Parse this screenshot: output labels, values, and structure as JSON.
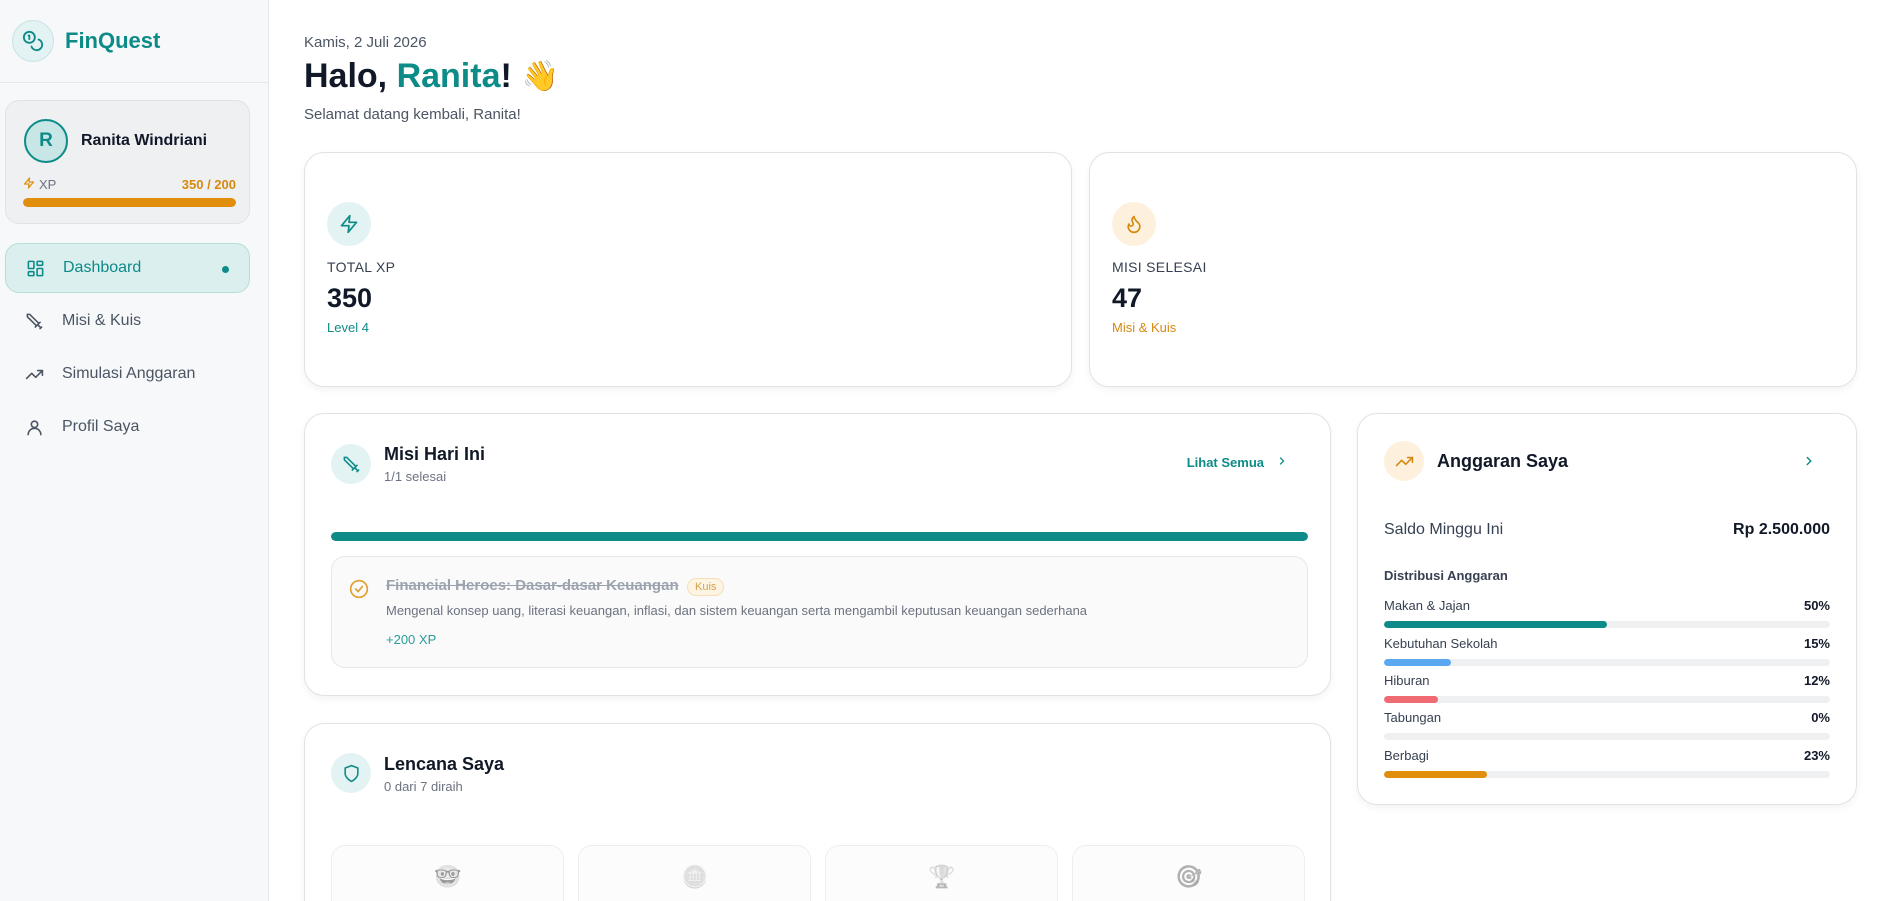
{
  "app": {
    "name": "FinQuest"
  },
  "user": {
    "initial": "R",
    "name": "Ranita Windriani",
    "xp_label": "XP",
    "xp_value": "350 / 200",
    "xp_progress": 1.0
  },
  "nav": {
    "items": [
      {
        "label": "Dashboard",
        "icon": "dashboard-icon",
        "active": true
      },
      {
        "label": "Misi & Kuis",
        "icon": "sword-icon"
      },
      {
        "label": "Simulasi Anggaran",
        "icon": "trending-up-icon"
      },
      {
        "label": "Profil Saya",
        "icon": "user-icon"
      }
    ]
  },
  "header": {
    "date": "Kamis, 2 Juli 2026",
    "greeting_prefix": "Halo, ",
    "greeting_name": "Ranita",
    "greeting_suffix": "!",
    "wave": "👋",
    "welcome": "Selamat datang kembali, Ranita!"
  },
  "stats": [
    {
      "label": "TOTAL XP",
      "value": "350",
      "sub": "Level 4",
      "icon": "lightning-icon",
      "color": "#0d8b88"
    },
    {
      "label": "MISI SELESAI",
      "value": "47",
      "sub": "Misi & Kuis",
      "icon": "flame-icon",
      "color": "#d68910"
    }
  ],
  "missions": {
    "title": "Misi Hari Ini",
    "subtitle": "1/1 selesai",
    "see_all": "Lihat Semua",
    "progress": 1.0,
    "items": [
      {
        "title": "Financial Heroes: Dasar-dasar Keuangan",
        "badge": "Kuis",
        "description": "Mengenal konsep uang, literasi keuangan, inflasi, dan sistem keuangan serta mengambil keputusan keuangan sederhana",
        "xp": "+200 XP",
        "done": true
      }
    ]
  },
  "badges": {
    "title": "Lencana Saya",
    "subtitle": "0 dari 7 diraih",
    "tiles": [
      {
        "icon": "hero-face-icon",
        "glyph": "🤓"
      },
      {
        "icon": "coin-icon",
        "glyph": "🪙"
      },
      {
        "icon": "trophy-icon",
        "glyph": "🏆"
      },
      {
        "icon": "target-icon",
        "glyph": "🎯"
      }
    ]
  },
  "budget": {
    "title": "Anggaran Saya",
    "balance_label": "Saldo Minggu Ini",
    "balance_value": "Rp 2.500.000",
    "distribution_label": "Distribusi Anggaran",
    "items": [
      {
        "label": "Makan & Jajan",
        "pct": "50%",
        "value": 0.5,
        "color": "#0d8b88"
      },
      {
        "label": "Kebutuhan Sekolah",
        "pct": "15%",
        "value": 0.15,
        "color": "#5aa9f0"
      },
      {
        "label": "Hiburan",
        "pct": "12%",
        "value": 0.12,
        "color": "#f06a72"
      },
      {
        "label": "Tabungan",
        "pct": "0%",
        "value": 0.0,
        "color": "#0d8b88"
      },
      {
        "label": "Berbagi",
        "pct": "23%",
        "value": 0.23,
        "color": "#e08e0b"
      }
    ]
  }
}
